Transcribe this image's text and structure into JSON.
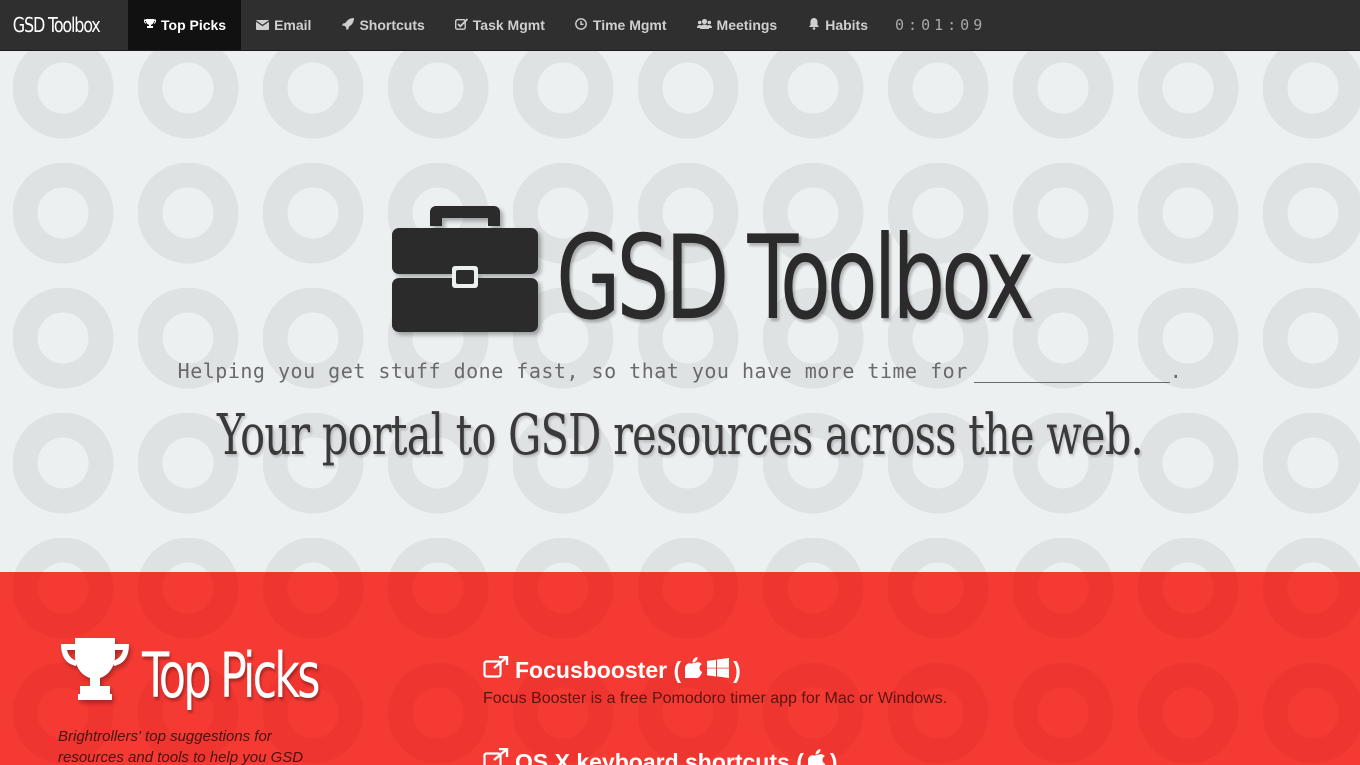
{
  "navbar": {
    "brand": "GSD Toolbox",
    "items": [
      {
        "label": "Top Picks",
        "icon": "trophy-icon",
        "active": true
      },
      {
        "label": "Email",
        "icon": "envelope-icon"
      },
      {
        "label": "Shortcuts",
        "icon": "rocket-icon"
      },
      {
        "label": "Task Mgmt",
        "icon": "checkbox-icon"
      },
      {
        "label": "Time Mgmt",
        "icon": "clock-icon"
      },
      {
        "label": "Meetings",
        "icon": "users-icon"
      },
      {
        "label": "Habits",
        "icon": "bell-icon"
      }
    ],
    "timer": "0:01:09"
  },
  "hero": {
    "title": "GSD Toolbox",
    "tagline": "Helping you get stuff done fast, so that you have more time for",
    "tagline_end": ".",
    "portal": "Your portal to GSD resources across the web."
  },
  "top_picks": {
    "title": "Top Picks",
    "description": "Brightrollers' top suggestions for resources and tools to help you GSD",
    "items": [
      {
        "title": "Focusbooster",
        "description": "Focus Booster is a free Pomodoro timer app for Mac or Windows.",
        "platforms": [
          "apple-icon",
          "windows-icon"
        ]
      },
      {
        "title": "OS X keyboard shortcuts",
        "description": "",
        "platforms": [
          "apple-icon"
        ]
      }
    ]
  },
  "colors": {
    "navbar": "#2f2f2f",
    "hero_bg": "#ecf0f1",
    "accent_red": "#f53a33"
  }
}
